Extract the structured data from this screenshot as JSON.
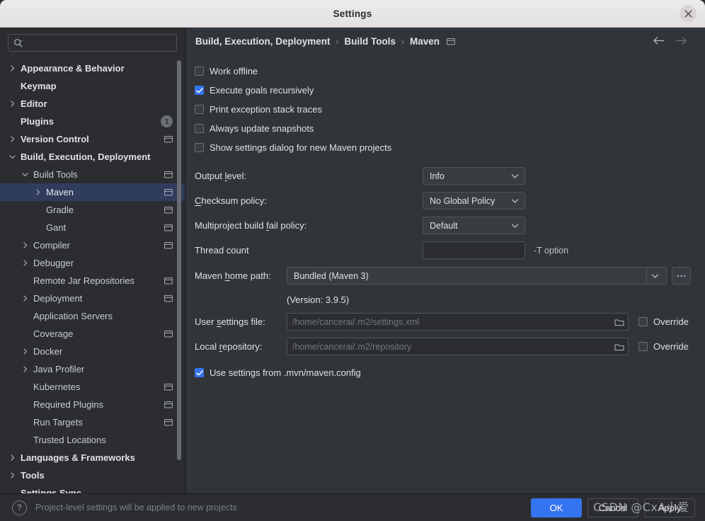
{
  "window": {
    "title": "Settings",
    "close_icon": "close-icon"
  },
  "sidebar": {
    "search": {
      "placeholder": "",
      "value": "",
      "icon": "search-icon"
    },
    "items": [
      {
        "label": "Appearance & Behavior",
        "level": 0,
        "twisty": "collapsed",
        "project_icon": false,
        "top": true,
        "selected": false
      },
      {
        "label": "Keymap",
        "level": 0,
        "twisty": "none",
        "project_icon": false,
        "top": true,
        "selected": false
      },
      {
        "label": "Editor",
        "level": 0,
        "twisty": "collapsed",
        "project_icon": false,
        "top": true,
        "selected": false
      },
      {
        "label": "Plugins",
        "level": 0,
        "twisty": "none",
        "project_icon": false,
        "top": true,
        "selected": false,
        "badge": "1"
      },
      {
        "label": "Version Control",
        "level": 0,
        "twisty": "collapsed",
        "project_icon": true,
        "top": true,
        "selected": false
      },
      {
        "label": "Build, Execution, Deployment",
        "level": 0,
        "twisty": "expanded",
        "project_icon": false,
        "top": true,
        "selected": false
      },
      {
        "label": "Build Tools",
        "level": 1,
        "twisty": "expanded",
        "project_icon": true,
        "top": false,
        "selected": false
      },
      {
        "label": "Maven",
        "level": 2,
        "twisty": "collapsed",
        "project_icon": true,
        "top": false,
        "selected": true
      },
      {
        "label": "Gradle",
        "level": 2,
        "twisty": "none",
        "project_icon": true,
        "top": false,
        "selected": false
      },
      {
        "label": "Gant",
        "level": 2,
        "twisty": "none",
        "project_icon": true,
        "top": false,
        "selected": false
      },
      {
        "label": "Compiler",
        "level": 1,
        "twisty": "collapsed",
        "project_icon": true,
        "top": false,
        "selected": false
      },
      {
        "label": "Debugger",
        "level": 1,
        "twisty": "collapsed",
        "project_icon": false,
        "top": false,
        "selected": false
      },
      {
        "label": "Remote Jar Repositories",
        "level": 1,
        "twisty": "none",
        "project_icon": true,
        "top": false,
        "selected": false
      },
      {
        "label": "Deployment",
        "level": 1,
        "twisty": "collapsed",
        "project_icon": true,
        "top": false,
        "selected": false
      },
      {
        "label": "Application Servers",
        "level": 1,
        "twisty": "none",
        "project_icon": false,
        "top": false,
        "selected": false
      },
      {
        "label": "Coverage",
        "level": 1,
        "twisty": "none",
        "project_icon": true,
        "top": false,
        "selected": false
      },
      {
        "label": "Docker",
        "level": 1,
        "twisty": "collapsed",
        "project_icon": false,
        "top": false,
        "selected": false
      },
      {
        "label": "Java Profiler",
        "level": 1,
        "twisty": "collapsed",
        "project_icon": false,
        "top": false,
        "selected": false
      },
      {
        "label": "Kubernetes",
        "level": 1,
        "twisty": "none",
        "project_icon": true,
        "top": false,
        "selected": false
      },
      {
        "label": "Required Plugins",
        "level": 1,
        "twisty": "none",
        "project_icon": true,
        "top": false,
        "selected": false
      },
      {
        "label": "Run Targets",
        "level": 1,
        "twisty": "none",
        "project_icon": true,
        "top": false,
        "selected": false
      },
      {
        "label": "Trusted Locations",
        "level": 1,
        "twisty": "none",
        "project_icon": false,
        "top": false,
        "selected": false
      },
      {
        "label": "Languages & Frameworks",
        "level": 0,
        "twisty": "collapsed",
        "project_icon": false,
        "top": true,
        "selected": false
      },
      {
        "label": "Tools",
        "level": 0,
        "twisty": "collapsed",
        "project_icon": false,
        "top": true,
        "selected": false
      },
      {
        "label": "Settings Sync",
        "level": 0,
        "twisty": "none",
        "project_icon": false,
        "top": true,
        "selected": false
      }
    ]
  },
  "main": {
    "breadcrumb": [
      "Build, Execution, Deployment",
      "Build Tools",
      "Maven"
    ],
    "breadcrumb_separator": "›",
    "project_scope_icon": "project-level-icon",
    "nav": {
      "back_icon": "arrow-left-icon",
      "forward_icon": "arrow-right-icon"
    },
    "checkboxes": [
      {
        "label": "Work offline",
        "checked": false
      },
      {
        "label": "Execute goals recursively",
        "checked": true
      },
      {
        "label": "Print exception stack traces",
        "checked": false
      },
      {
        "label": "Always update snapshots",
        "checked": false
      },
      {
        "label": "Show settings dialog for new Maven projects",
        "checked": false
      }
    ],
    "output_level": {
      "label_pre": "Output ",
      "label_mnemonic": "l",
      "label_post": "evel:",
      "value": "Info"
    },
    "checksum_policy": {
      "label_pre": "",
      "label_mnemonic": "C",
      "label_post": "hecksum policy:",
      "value": "No Global Policy"
    },
    "multiproject_fail_policy": {
      "label_pre": "Multiproject build ",
      "label_mnemonic": "f",
      "label_post": "ail policy:",
      "value": "Default"
    },
    "thread_count": {
      "label": "Thread count",
      "value": "",
      "placeholder": "",
      "hint": "-T option"
    },
    "maven_home_path": {
      "label_pre": "Maven ",
      "label_mnemonic": "h",
      "label_post": "ome path:",
      "value": "Bundled (Maven 3)",
      "browse_label": "...",
      "version_line": "(Version: 3.9.5)"
    },
    "user_settings_file": {
      "label_pre": "User ",
      "label_mnemonic": "s",
      "label_post": "ettings file:",
      "value": "",
      "placeholder": "/home/cancerai/.m2/settings.xml",
      "folder_icon": "folder-icon",
      "override_label": "Override",
      "override_checked": false
    },
    "local_repository": {
      "label_pre": "Local ",
      "label_mnemonic": "r",
      "label_post": "epository:",
      "value": "",
      "placeholder": "/home/cancerai/.m2/repository",
      "folder_icon": "folder-icon",
      "override_label": "Override",
      "override_checked": false
    },
    "use_mvn_config": {
      "label": "Use settings from .mvn/maven.config",
      "checked": true
    }
  },
  "footer": {
    "help_icon": "?",
    "note": "Project-level settings will be applied to new projects",
    "ok_label": "OK",
    "cancel_label": "Cancel",
    "apply_label": "Apply"
  },
  "watermark": {
    "text": "CSDN @CxA小爱"
  },
  "colors": {
    "accent": "#3574f0",
    "selection": "#2f3c5c",
    "sidebar_bg": "#2b2d30",
    "panel_bg": "#313438",
    "titlebar_bg": "#ebe9e9",
    "text": "#dfe1e5",
    "muted_text": "#7d8189"
  }
}
